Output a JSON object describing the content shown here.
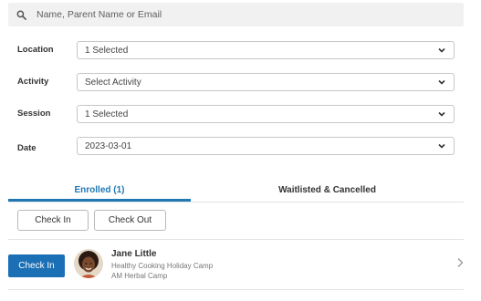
{
  "search": {
    "placeholder": "Name, Parent Name or Email"
  },
  "filters": [
    {
      "label": "Location",
      "value": "1 Selected"
    },
    {
      "label": "Activity",
      "value": "Select Activity"
    },
    {
      "label": "Session",
      "value": "1 Selected"
    },
    {
      "label": "Date",
      "value": "2023-03-01"
    }
  ],
  "tabs": {
    "enrolled": "Enrolled (1)",
    "waitlisted": "Waitlisted & Cancelled",
    "active": "enrolled"
  },
  "actions": {
    "check_in": "Check In",
    "check_out": "Check Out"
  },
  "enrollees": [
    {
      "button": "Check In",
      "name": "Jane Little",
      "program": "Healthy Cooking Holiday Camp",
      "session": "AM Herbal Camp"
    }
  ],
  "colors": {
    "accent": "#1f78b4",
    "button": "#1b6fb5"
  }
}
